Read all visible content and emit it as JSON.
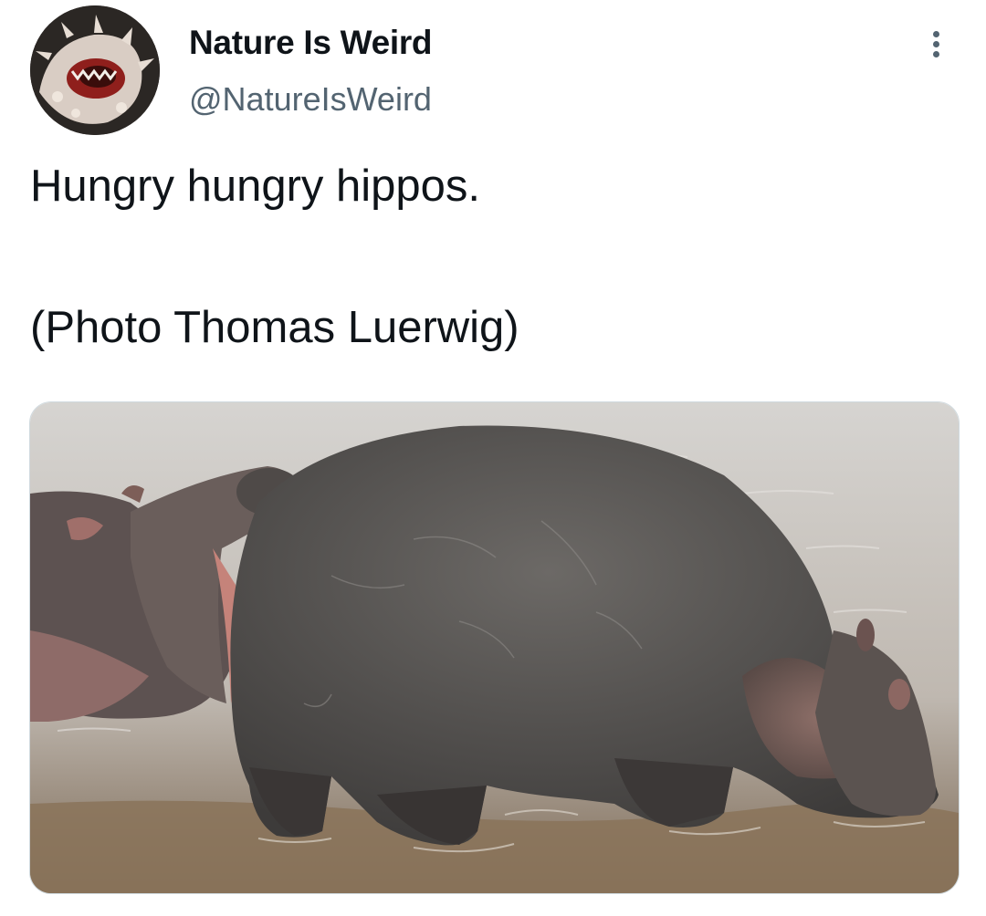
{
  "tweet": {
    "author": {
      "name": "Nature Is Weird",
      "handle": "@NatureIsWeird"
    },
    "text_lines": [
      "Hungry hungry hippos.",
      "(Photo Thomas Luerwig)"
    ],
    "media": {
      "alt": "Two hippos standing in shallow water"
    }
  }
}
